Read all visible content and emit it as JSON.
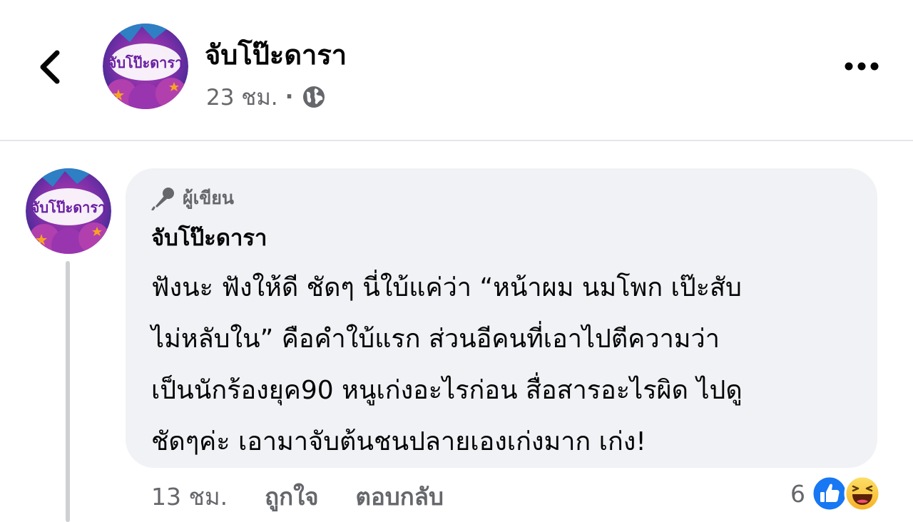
{
  "header": {
    "page_name": "จับโป๊ะดารา",
    "time": "23 ชม.",
    "separator": "·",
    "avatar_label": "จับโป๊ะดารา",
    "icons": {
      "back": "chevron-left-icon",
      "more": "more-horizontal-icon",
      "privacy": "globe-icon"
    }
  },
  "comment": {
    "author_badge": "ผู้เขียน",
    "author_badge_icon": "microphone-icon",
    "name": "จับโป๊ะดารา",
    "text_lines": [
      "ฟังนะ ฟังให้ดี ชัดๆ นี่ใบ้แค่ว่า “หน้าผม นมโพก เป๊ะสับ",
      "ไม่หลับใน” คือคำใบ้แรก ส่วนอีคนที่เอาไปตีความว่า",
      "เป็นนักร้องยุค90 หนูเก่งอะไรก่อน สื่อสารอะไรผิด ไปดู",
      "ชัดๆค่ะ เอามาจับต้นชนปลายเองเก่งมาก เก่ง!"
    ],
    "time": "13 ชม.",
    "like_label": "ถูกใจ",
    "reply_label": "ตอบกลับ",
    "reaction_count": "6",
    "reaction_icons": [
      "like-icon",
      "haha-icon"
    ]
  },
  "colors": {
    "bubble_bg": "#f0f2f5",
    "secondary_text": "#65676b",
    "like_blue": "#1877f2",
    "haha_yellow": "#f7b125"
  }
}
